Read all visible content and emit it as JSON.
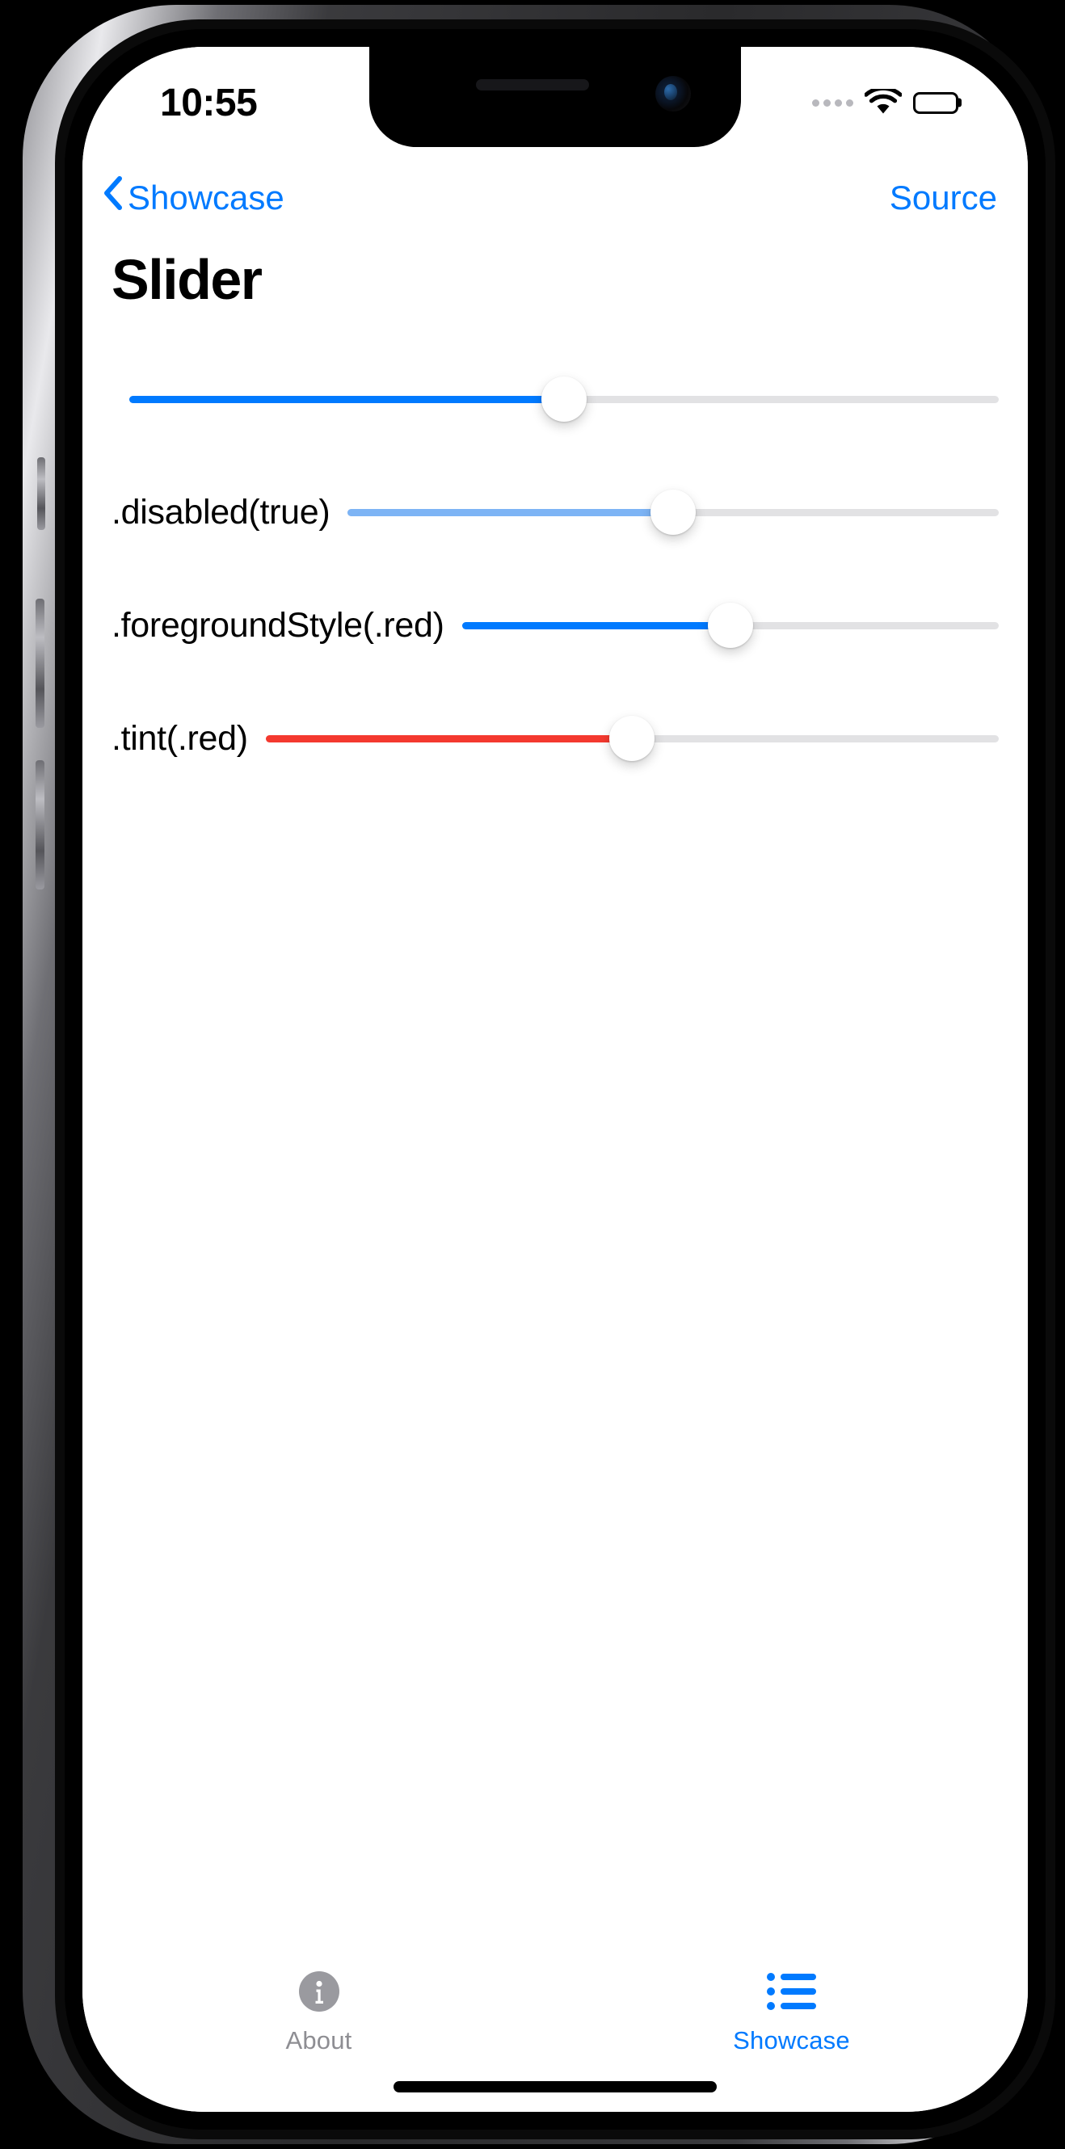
{
  "status_bar": {
    "time": "10:55",
    "cellular_icon": "cellular-dots-icon",
    "wifi_icon": "wifi-icon",
    "battery_icon": "battery-full-icon",
    "battery_level_percent": 100
  },
  "nav_bar": {
    "back_icon": "chevron-left-icon",
    "back_label": "Showcase",
    "action_label": "Source",
    "tint_color": "#007aff"
  },
  "page_title": "Slider",
  "sliders": [
    {
      "label": "",
      "value_percent": 50,
      "fill_color": "#007aff",
      "track_color": "#e2e2e4",
      "thumb_color": "#ffffff",
      "disabled": false
    },
    {
      "label": ".disabled(true)",
      "value_percent": 50,
      "fill_color": "#7db4f5",
      "track_color": "#e2e2e4",
      "thumb_color": "#ffffff",
      "disabled": true
    },
    {
      "label": ".foregroundStyle(.red)",
      "value_percent": 50,
      "fill_color": "#007aff",
      "track_color": "#e2e2e4",
      "thumb_color": "#ffffff",
      "disabled": false
    },
    {
      "label": ".tint(.red)",
      "value_percent": 50,
      "fill_color": "#f4392f",
      "track_color": "#e2e2e4",
      "thumb_color": "#ffffff",
      "disabled": false
    }
  ],
  "tab_bar": {
    "items": [
      {
        "label": "About",
        "icon": "info-circle-fill-icon",
        "active": false,
        "color": "#8e8e93"
      },
      {
        "label": "Showcase",
        "icon": "list-bullet-icon",
        "active": true,
        "color": "#007aff"
      }
    ]
  }
}
